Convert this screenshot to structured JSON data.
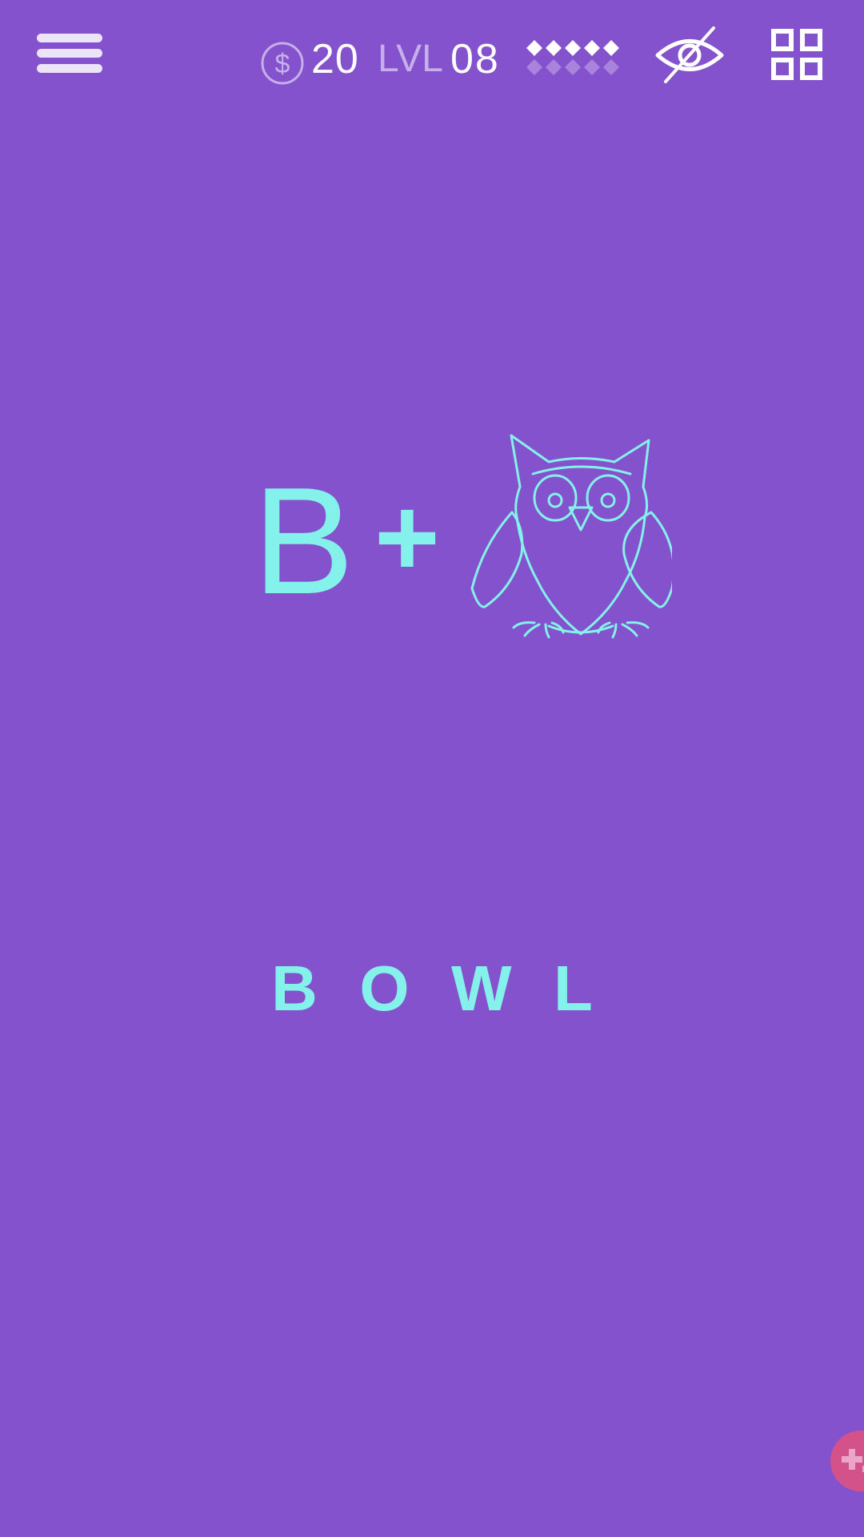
{
  "header": {
    "menu_icon": "hamburger-menu-icon",
    "coin_icon": "dollar-coin-icon",
    "coins": "20",
    "level_label": "LVL",
    "level": "08",
    "progress_icon": "diamond-progress-icon",
    "progress_completed": 5,
    "progress_total": 10,
    "hide_icon": "eye-slash-icon",
    "levels_icon": "grid-icon"
  },
  "puzzle": {
    "letter": "B",
    "operator": "+",
    "image_icon": "owl-icon"
  },
  "answer": {
    "letters": [
      "B",
      "O",
      "W",
      "L"
    ]
  },
  "hint_icon": "plus-sparkle-icon",
  "colors": {
    "background": "#8452cc",
    "accent": "#84f1ea",
    "header_text": "#ffffff",
    "muted_text": "#c7b0ea",
    "hint_button": "#d4528a"
  }
}
